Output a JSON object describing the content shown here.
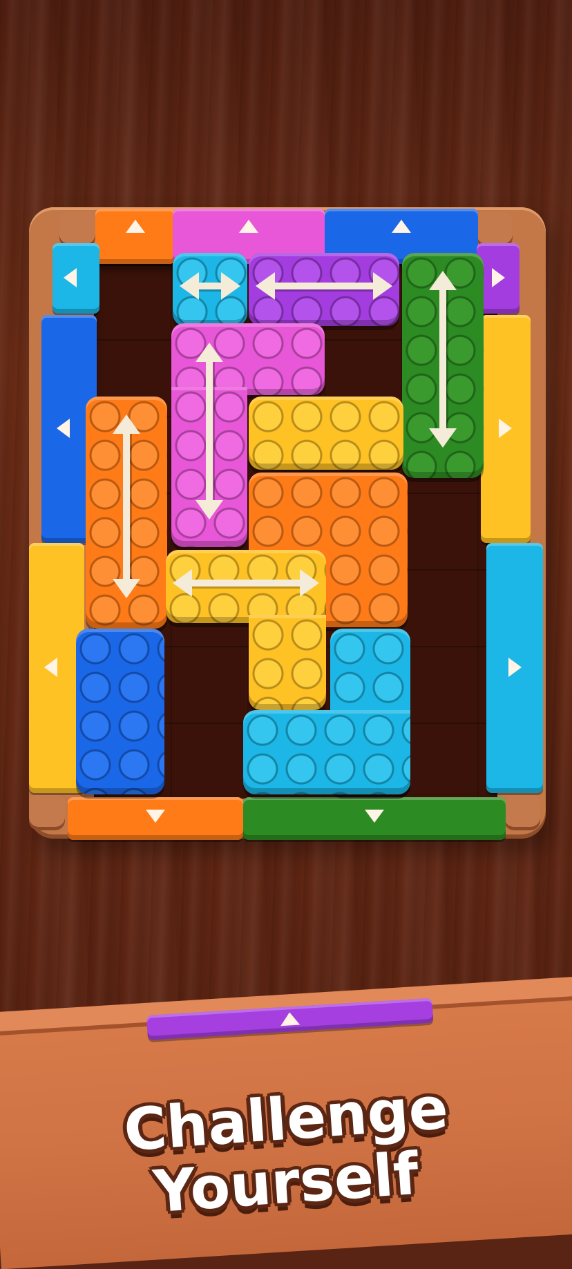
{
  "scene": "block-slide-puzzle",
  "colors": {
    "orange": "#ff7b18",
    "pink": "#e857d8",
    "blue": "#1a67e8",
    "cyan": "#1cb7e6",
    "purple": "#a43ddf",
    "green": "#2c8b22",
    "yellow": "#ffc225",
    "board": "#c47848",
    "pit": "#3a1209"
  },
  "gates": [
    {
      "color": "orange",
      "dir": "up"
    },
    {
      "color": "pink",
      "dir": "up"
    },
    {
      "color": "blue",
      "dir": "up"
    },
    {
      "color": "cyan",
      "dir": "left"
    },
    {
      "color": "blue",
      "dir": "left"
    },
    {
      "color": "yellow",
      "dir": "left"
    },
    {
      "color": "purple",
      "dir": "right"
    },
    {
      "color": "yellow",
      "dir": "right"
    },
    {
      "color": "cyan",
      "dir": "right"
    },
    {
      "color": "orange",
      "dir": "down"
    },
    {
      "color": "green",
      "dir": "down"
    }
  ],
  "blocks": [
    {
      "color": "cyan",
      "move": "horizontal"
    },
    {
      "color": "purple",
      "move": "horizontal"
    },
    {
      "color": "green",
      "move": "vertical"
    },
    {
      "color": "pink",
      "move": "vertical"
    },
    {
      "color": "orange",
      "move": "vertical"
    },
    {
      "color": "yellow",
      "move": "none"
    },
    {
      "color": "orange",
      "move": "none"
    },
    {
      "color": "yellow",
      "move": "horizontal"
    },
    {
      "color": "blue",
      "move": "none"
    },
    {
      "color": "cyan",
      "move": "none"
    }
  ],
  "tray": {
    "piece_color": "purple",
    "dir": "up"
  },
  "headline": {
    "line1": "Challenge",
    "line2": "Yourself"
  }
}
